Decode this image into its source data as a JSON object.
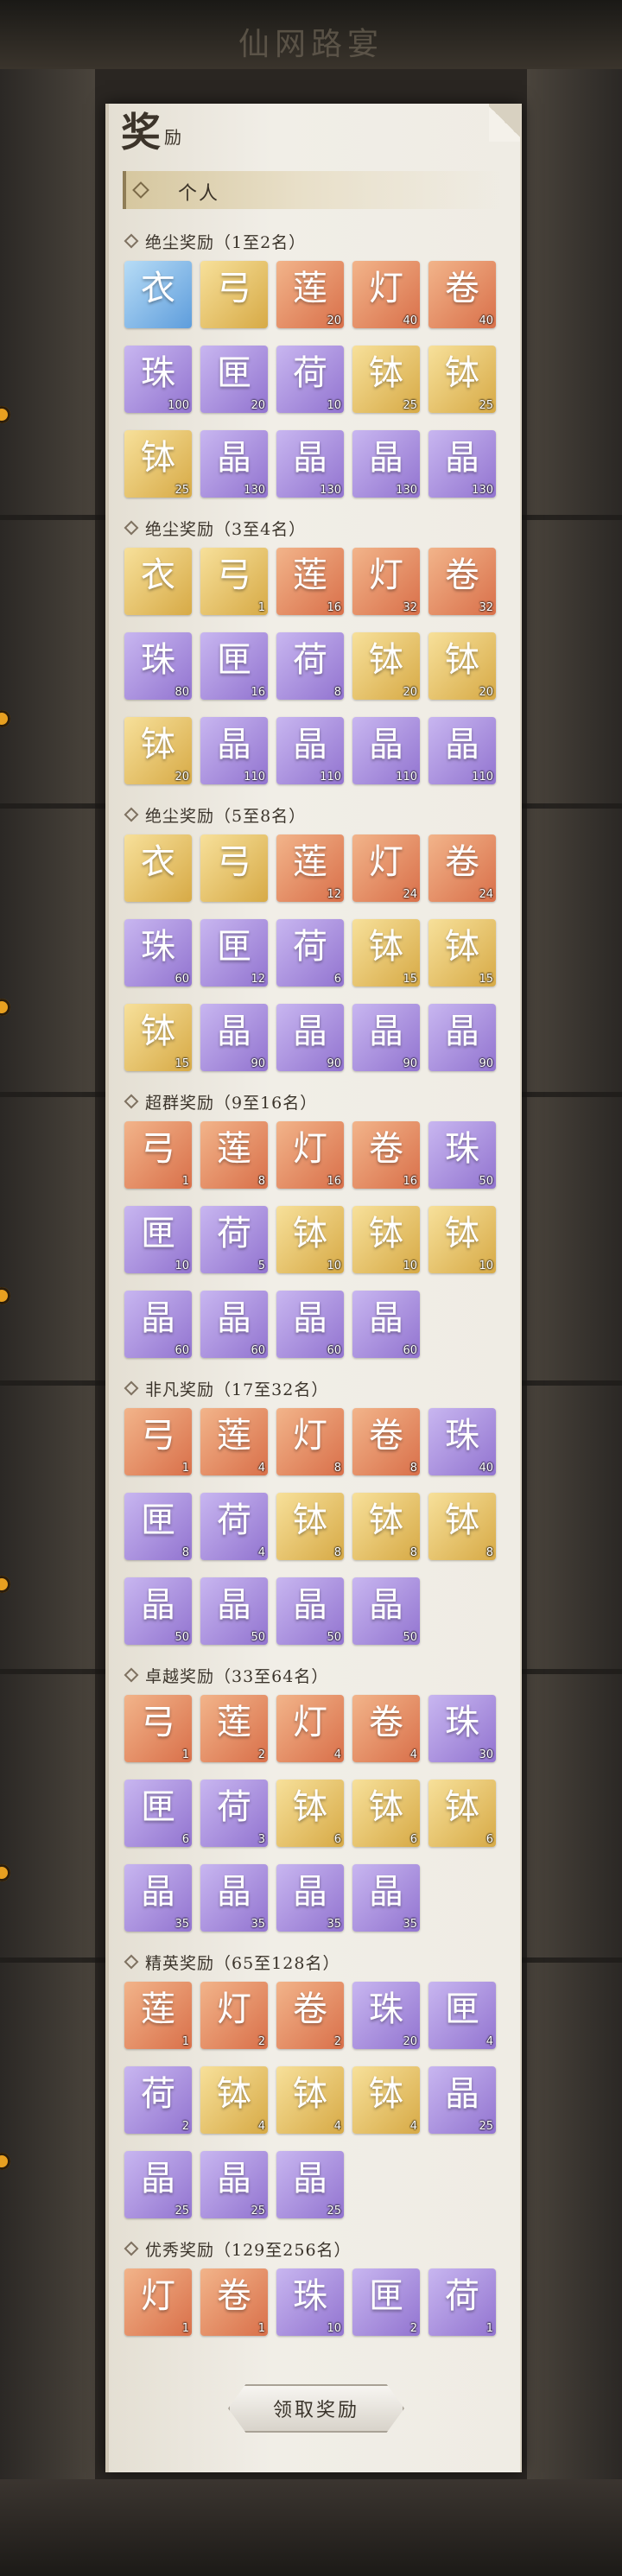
{
  "background_title": "仙网路宴",
  "panel": {
    "title_big": "奖",
    "title_small": "励"
  },
  "tab": {
    "label": "个人"
  },
  "claim_button": {
    "label": "领取奖励"
  },
  "icon_colors": {
    "orange": "#d9704a",
    "purple": "#9274d0",
    "gold": "#d7aa46",
    "blue": "#5e9ddc"
  },
  "sections": [
    {
      "title": "绝尘奖励（1至2名）",
      "items": [
        {
          "icon": "blue-robe-icon",
          "tone": "blue",
          "count": ""
        },
        {
          "icon": "golden-bow-icon",
          "tone": "gold",
          "count": ""
        },
        {
          "icon": "red-lotus-icon",
          "tone": "orange",
          "count": "20"
        },
        {
          "icon": "red-lantern-icon",
          "tone": "orange",
          "count": "40"
        },
        {
          "icon": "gold-scroll-icon",
          "tone": "orange",
          "count": "40"
        },
        {
          "icon": "purple-orb-icon",
          "tone": "purple",
          "count": "100"
        },
        {
          "icon": "blue-treasure-chest-icon",
          "tone": "purple",
          "count": "20"
        },
        {
          "icon": "pink-lotus-icon",
          "tone": "purple",
          "count": "10"
        },
        {
          "icon": "blue-bowl-icon",
          "tone": "gold",
          "count": "25"
        },
        {
          "icon": "green-bowl-icon",
          "tone": "gold",
          "count": "25"
        },
        {
          "icon": "orange-bowl-icon",
          "tone": "gold",
          "count": "25"
        },
        {
          "icon": "green-gem-box-icon",
          "tone": "purple",
          "count": "130"
        },
        {
          "icon": "red-gem-box-icon",
          "tone": "purple",
          "count": "130"
        },
        {
          "icon": "purple-gem-box-icon",
          "tone": "purple",
          "count": "130"
        },
        {
          "icon": "blue-gem-box-icon",
          "tone": "purple",
          "count": "130"
        }
      ]
    },
    {
      "title": "绝尘奖励（3至4名）",
      "items": [
        {
          "icon": "blue-robe-icon",
          "tone": "gold",
          "count": ""
        },
        {
          "icon": "golden-bow-icon",
          "tone": "gold",
          "count": "1"
        },
        {
          "icon": "red-lotus-icon",
          "tone": "orange",
          "count": "16"
        },
        {
          "icon": "red-lantern-icon",
          "tone": "orange",
          "count": "32"
        },
        {
          "icon": "gold-scroll-icon",
          "tone": "orange",
          "count": "32"
        },
        {
          "icon": "purple-orb-icon",
          "tone": "purple",
          "count": "80"
        },
        {
          "icon": "blue-treasure-chest-icon",
          "tone": "purple",
          "count": "16"
        },
        {
          "icon": "pink-lotus-icon",
          "tone": "purple",
          "count": "8"
        },
        {
          "icon": "blue-bowl-icon",
          "tone": "gold",
          "count": "20"
        },
        {
          "icon": "green-bowl-icon",
          "tone": "gold",
          "count": "20"
        },
        {
          "icon": "orange-bowl-icon",
          "tone": "gold",
          "count": "20"
        },
        {
          "icon": "green-gem-box-icon",
          "tone": "purple",
          "count": "110"
        },
        {
          "icon": "red-gem-box-icon",
          "tone": "purple",
          "count": "110"
        },
        {
          "icon": "purple-gem-box-icon",
          "tone": "purple",
          "count": "110"
        },
        {
          "icon": "blue-gem-box-icon",
          "tone": "purple",
          "count": "110"
        }
      ]
    },
    {
      "title": "绝尘奖励（5至8名）",
      "items": [
        {
          "icon": "blue-robe-icon",
          "tone": "gold",
          "count": ""
        },
        {
          "icon": "golden-bow-icon",
          "tone": "gold",
          "count": ""
        },
        {
          "icon": "red-lotus-icon",
          "tone": "orange",
          "count": "12"
        },
        {
          "icon": "red-lantern-icon",
          "tone": "orange",
          "count": "24"
        },
        {
          "icon": "gold-scroll-icon",
          "tone": "orange",
          "count": "24"
        },
        {
          "icon": "purple-orb-icon",
          "tone": "purple",
          "count": "60"
        },
        {
          "icon": "blue-treasure-chest-icon",
          "tone": "purple",
          "count": "12"
        },
        {
          "icon": "pink-lotus-icon",
          "tone": "purple",
          "count": "6"
        },
        {
          "icon": "blue-bowl-icon",
          "tone": "gold",
          "count": "15"
        },
        {
          "icon": "green-bowl-icon",
          "tone": "gold",
          "count": "15"
        },
        {
          "icon": "orange-bowl-icon",
          "tone": "gold",
          "count": "15"
        },
        {
          "icon": "green-gem-box-icon",
          "tone": "purple",
          "count": "90"
        },
        {
          "icon": "red-gem-box-icon",
          "tone": "purple",
          "count": "90"
        },
        {
          "icon": "purple-gem-box-icon",
          "tone": "purple",
          "count": "90"
        },
        {
          "icon": "blue-gem-box-icon",
          "tone": "purple",
          "count": "90"
        }
      ]
    },
    {
      "title": "超群奖励（9至16名）",
      "items": [
        {
          "icon": "golden-bow-icon",
          "tone": "orange",
          "count": "1"
        },
        {
          "icon": "red-lotus-icon",
          "tone": "orange",
          "count": "8"
        },
        {
          "icon": "red-lantern-icon",
          "tone": "orange",
          "count": "16"
        },
        {
          "icon": "gold-scroll-icon",
          "tone": "orange",
          "count": "16"
        },
        {
          "icon": "purple-orb-icon",
          "tone": "purple",
          "count": "50"
        },
        {
          "icon": "blue-treasure-chest-icon",
          "tone": "purple",
          "count": "10"
        },
        {
          "icon": "pink-lotus-icon",
          "tone": "purple",
          "count": "5"
        },
        {
          "icon": "blue-bowl-icon",
          "tone": "gold",
          "count": "10"
        },
        {
          "icon": "green-bowl-icon",
          "tone": "gold",
          "count": "10"
        },
        {
          "icon": "orange-bowl-icon",
          "tone": "gold",
          "count": "10"
        },
        {
          "icon": "green-gem-box-icon",
          "tone": "purple",
          "count": "60"
        },
        {
          "icon": "red-gem-box-icon",
          "tone": "purple",
          "count": "60"
        },
        {
          "icon": "purple-gem-box-icon",
          "tone": "purple",
          "count": "60"
        },
        {
          "icon": "blue-gem-box-icon",
          "tone": "purple",
          "count": "60"
        }
      ]
    },
    {
      "title": "非凡奖励（17至32名）",
      "items": [
        {
          "icon": "golden-bow-icon",
          "tone": "orange",
          "count": "1"
        },
        {
          "icon": "red-lotus-icon",
          "tone": "orange",
          "count": "4"
        },
        {
          "icon": "red-lantern-icon",
          "tone": "orange",
          "count": "8"
        },
        {
          "icon": "gold-scroll-icon",
          "tone": "orange",
          "count": "8"
        },
        {
          "icon": "purple-orb-icon",
          "tone": "purple",
          "count": "40"
        },
        {
          "icon": "blue-treasure-chest-icon",
          "tone": "purple",
          "count": "8"
        },
        {
          "icon": "pink-lotus-icon",
          "tone": "purple",
          "count": "4"
        },
        {
          "icon": "blue-bowl-icon",
          "tone": "gold",
          "count": "8"
        },
        {
          "icon": "green-bowl-icon",
          "tone": "gold",
          "count": "8"
        },
        {
          "icon": "orange-bowl-icon",
          "tone": "gold",
          "count": "8"
        },
        {
          "icon": "green-gem-box-icon",
          "tone": "purple",
          "count": "50"
        },
        {
          "icon": "red-gem-box-icon",
          "tone": "purple",
          "count": "50"
        },
        {
          "icon": "purple-gem-box-icon",
          "tone": "purple",
          "count": "50"
        },
        {
          "icon": "blue-gem-box-icon",
          "tone": "purple",
          "count": "50"
        }
      ]
    },
    {
      "title": "卓越奖励（33至64名）",
      "items": [
        {
          "icon": "golden-bow-icon",
          "tone": "orange",
          "count": "1"
        },
        {
          "icon": "red-lotus-icon",
          "tone": "orange",
          "count": "2"
        },
        {
          "icon": "red-lantern-icon",
          "tone": "orange",
          "count": "4"
        },
        {
          "icon": "gold-scroll-icon",
          "tone": "orange",
          "count": "4"
        },
        {
          "icon": "purple-orb-icon",
          "tone": "purple",
          "count": "30"
        },
        {
          "icon": "blue-treasure-chest-icon",
          "tone": "purple",
          "count": "6"
        },
        {
          "icon": "pink-lotus-icon",
          "tone": "purple",
          "count": "3"
        },
        {
          "icon": "blue-bowl-icon",
          "tone": "gold",
          "count": "6"
        },
        {
          "icon": "green-bowl-icon",
          "tone": "gold",
          "count": "6"
        },
        {
          "icon": "orange-bowl-icon",
          "tone": "gold",
          "count": "6"
        },
        {
          "icon": "green-gem-box-icon",
          "tone": "purple",
          "count": "35"
        },
        {
          "icon": "red-gem-box-icon",
          "tone": "purple",
          "count": "35"
        },
        {
          "icon": "purple-gem-box-icon",
          "tone": "purple",
          "count": "35"
        },
        {
          "icon": "blue-gem-box-icon",
          "tone": "purple",
          "count": "35"
        }
      ]
    },
    {
      "title": "精英奖励（65至128名）",
      "items": [
        {
          "icon": "red-lotus-icon",
          "tone": "orange",
          "count": "1"
        },
        {
          "icon": "red-lantern-icon",
          "tone": "orange",
          "count": "2"
        },
        {
          "icon": "gold-scroll-icon",
          "tone": "orange",
          "count": "2"
        },
        {
          "icon": "purple-orb-icon",
          "tone": "purple",
          "count": "20"
        },
        {
          "icon": "blue-treasure-chest-icon",
          "tone": "purple",
          "count": "4"
        },
        {
          "icon": "pink-lotus-icon",
          "tone": "purple",
          "count": "2"
        },
        {
          "icon": "blue-bowl-icon",
          "tone": "gold",
          "count": "4"
        },
        {
          "icon": "green-bowl-icon",
          "tone": "gold",
          "count": "4"
        },
        {
          "icon": "orange-bowl-icon",
          "tone": "gold",
          "count": "4"
        },
        {
          "icon": "red-gem-box-icon",
          "tone": "purple",
          "count": "25"
        },
        {
          "icon": "red-gem-box-icon",
          "tone": "purple",
          "count": "25"
        },
        {
          "icon": "purple-gem-box-icon",
          "tone": "purple",
          "count": "25"
        },
        {
          "icon": "blue-gem-box-icon",
          "tone": "purple",
          "count": "25"
        }
      ]
    },
    {
      "title": "优秀奖励（129至256名）",
      "items": [
        {
          "icon": "red-lantern-icon",
          "tone": "orange",
          "count": "1"
        },
        {
          "icon": "gold-scroll-icon",
          "tone": "orange",
          "count": "1"
        },
        {
          "icon": "purple-orb-icon",
          "tone": "purple",
          "count": "10"
        },
        {
          "icon": "blue-treasure-chest-icon",
          "tone": "purple",
          "count": "2"
        },
        {
          "icon": "pink-lotus-icon",
          "tone": "purple",
          "count": "1"
        }
      ]
    }
  ]
}
